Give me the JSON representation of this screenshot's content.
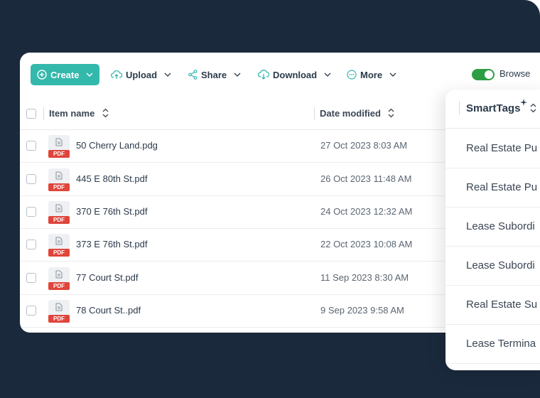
{
  "toolbar": {
    "create_label": "Create",
    "upload_label": "Upload",
    "share_label": "Share",
    "download_label": "Download",
    "more_label": "More",
    "browse_label": "Browse",
    "browse_toggle_on": true
  },
  "table": {
    "columns": [
      "Item name",
      "Date modified"
    ],
    "file_tag": "PDF",
    "rows": [
      {
        "name": "50 Cherry Land.pdg",
        "date": "27 Oct 2023 8:03 AM"
      },
      {
        "name": "445 E 80th St.pdf",
        "date": "26 Oct 2023 11:48 AM"
      },
      {
        "name": "370 E 76th St.pdf",
        "date": "24 Oct 2023 12:32 AM"
      },
      {
        "name": "373 E 76th St.pdf",
        "date": "22 Oct 2023 10:08 AM"
      },
      {
        "name": "77 Court St.pdf",
        "date": "11 Sep 2023 8:30 AM"
      },
      {
        "name": "78 Court St..pdf",
        "date": "9 Sep 2023 9:58 AM"
      }
    ]
  },
  "smarttags": {
    "title": "SmartTags",
    "items": [
      "Real Estate Pu",
      "Real Estate Pu",
      "Lease Subordi",
      "Lease Subordi",
      "Real Estate Su",
      "Lease Termina"
    ]
  },
  "colors": {
    "background": "#1a2a3c",
    "accent": "#33b8ac",
    "toggle": "#2e9e44",
    "pdf_badge": "#e0443a"
  }
}
